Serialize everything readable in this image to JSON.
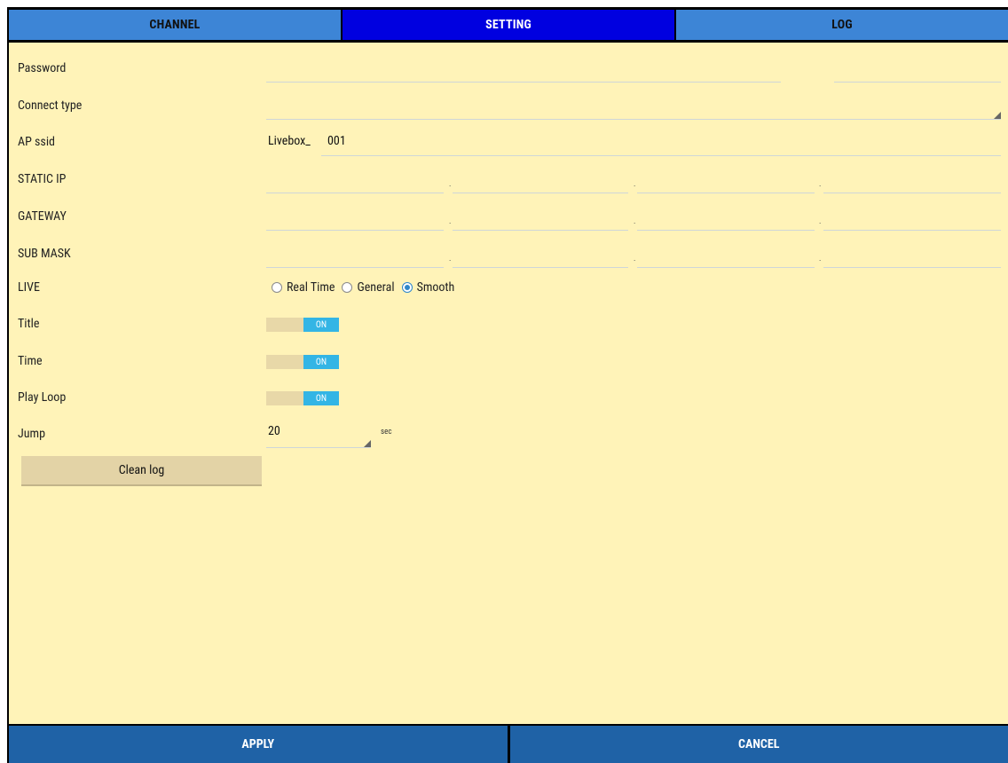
{
  "tabs": [
    {
      "label": "CHANNEL",
      "active": false
    },
    {
      "label": "SETTING",
      "active": true
    },
    {
      "label": "LOG",
      "active": false
    }
  ],
  "settings": {
    "password": {
      "label": "Password",
      "value": ""
    },
    "connect_type": {
      "label": "Connect type",
      "value": ""
    },
    "ap_ssid": {
      "label": "AP ssid",
      "prefix": "Livebox_",
      "value": "001"
    },
    "static_ip": {
      "label": "STATIC IP",
      "octets": [
        "",
        "",
        "",
        ""
      ],
      "separator": "."
    },
    "gateway": {
      "label": "GATEWAY",
      "octets": [
        "",
        "",
        "",
        ""
      ],
      "separator": "."
    },
    "sub_mask": {
      "label": "SUB MASK",
      "octets": [
        "",
        "",
        "",
        ""
      ],
      "separator": "."
    },
    "live": {
      "label": "LIVE",
      "options": [
        {
          "label": "Real Time",
          "selected": false
        },
        {
          "label": "General",
          "selected": false
        },
        {
          "label": "Smooth",
          "selected": true
        }
      ]
    },
    "title": {
      "label": "Title",
      "state": "ON"
    },
    "time": {
      "label": "Time",
      "state": "ON"
    },
    "play_loop": {
      "label": "Play Loop",
      "state": "ON"
    },
    "jump": {
      "label": "Jump",
      "value": "20",
      "unit": "sec"
    },
    "clean_log": {
      "label": "Clean log"
    }
  },
  "footer": {
    "apply_label": "APPLY",
    "cancel_label": "CANCEL"
  },
  "colors": {
    "tab": "#3d85d6",
    "tab_active": "#0000e0",
    "panel_bg": "#fff3b8",
    "toggle_on": "#33b5e5",
    "footer": "#1f62a6",
    "radio_accent": "#2f86c9"
  }
}
